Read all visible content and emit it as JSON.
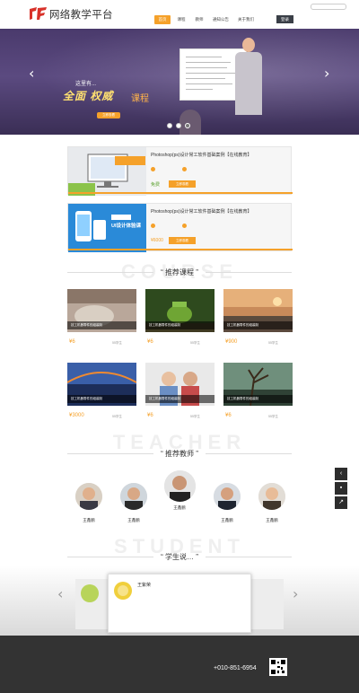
{
  "header": {
    "brand": "网络教学平台",
    "nav": [
      "首页",
      "课程",
      "教师",
      "通知公告",
      "关于我们"
    ],
    "login": "登录"
  },
  "banner": {
    "small_text": "这里有...",
    "title": "全面 权威",
    "course_word": "课程",
    "button": "立即查看",
    "whiteboard_lines": 7
  },
  "featured": [
    {
      "title": "Photoshop(ps)设计常工软件基础案例【在线教育】",
      "price": "免费",
      "button": "立即观看"
    },
    {
      "title": "Photoshop(ps)设计常工软件基础案例【在线教育】",
      "price": "¥6000",
      "button": "立即观看",
      "image_text": "UI设计体验课"
    }
  ],
  "sections": {
    "courses": {
      "title": "“ 推荐课程 ”",
      "bg": "COURSE"
    },
    "teachers": {
      "title": "“ 推荐教师 ”",
      "bg": "TEACHER"
    },
    "students": {
      "title": "“ 学生说… ”",
      "bg": "STUDENT"
    }
  },
  "courses": [
    {
      "caption": "技工机器零件的组装制",
      "price": "¥6",
      "learners": "55学生"
    },
    {
      "caption": "技工机器零件的组装制",
      "price": "¥6",
      "learners": "55学生"
    },
    {
      "caption": "技工机器零件的组装制",
      "price": "¥900",
      "learners": "55学生"
    },
    {
      "caption": "技工机器零件的组装制",
      "price": "¥3000",
      "learners": "55学生"
    },
    {
      "caption": "技工机器零件的组装制",
      "price": "¥6",
      "learners": "55学生"
    },
    {
      "caption": "技工机器零件的组装制",
      "price": "¥6",
      "learners": "55学生"
    }
  ],
  "teachers": [
    {
      "name": "王鑫鹏"
    },
    {
      "name": "王鑫鹏"
    },
    {
      "name": "王鑫鹏"
    },
    {
      "name": "王鑫鹏"
    },
    {
      "name": "王鑫鹏"
    }
  ],
  "student": {
    "name": "王紫荣"
  },
  "footer": {
    "phone": "+010-851-6954"
  },
  "colors": {
    "accent": "#f5a12a",
    "banner": "#4a3a6c",
    "footer": "#333333"
  }
}
